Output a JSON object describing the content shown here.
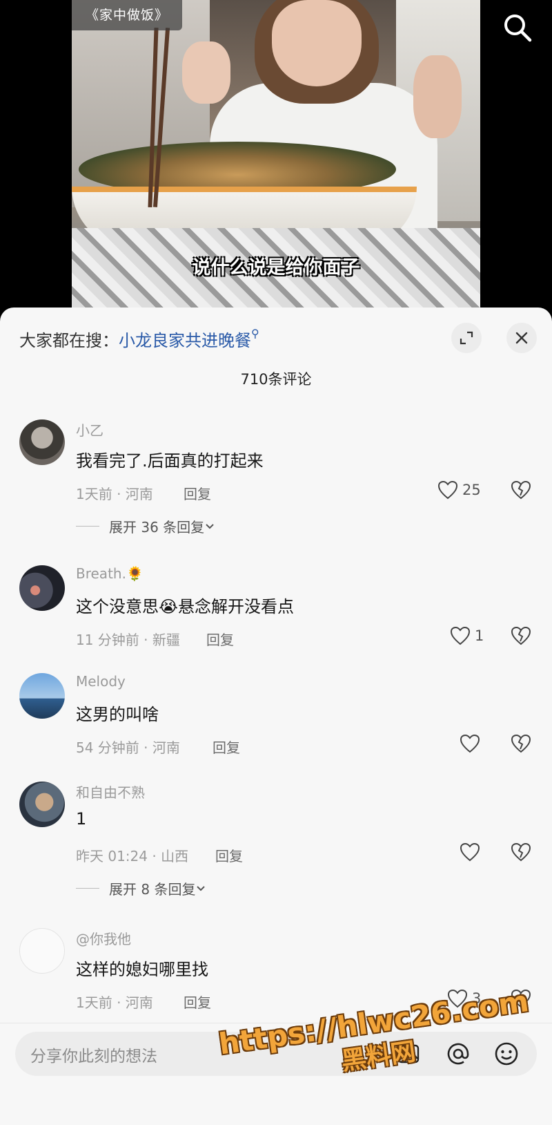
{
  "video": {
    "tag": "《家中做饭》",
    "subtitle": "说什么说是给你面子"
  },
  "sheet": {
    "search_prefix": "大家都在搜：",
    "search_keyword": "小龙良家共进晚餐",
    "comment_count": "710条评论"
  },
  "comments": [
    {
      "name": "小乙",
      "text": "我看完了.后面真的打起来",
      "meta": "1天前 · 河南",
      "reply": "回复",
      "likes": "25",
      "expand": "展开 36 条回复"
    },
    {
      "name": "Breath.🌻",
      "text": "这个没意思😭悬念解开没看点",
      "meta": "11 分钟前 · 新疆",
      "reply": "回复",
      "likes": "1"
    },
    {
      "name": "Melody",
      "text": "这男的叫啥",
      "meta": "54 分钟前 · 河南",
      "reply": "回复",
      "likes": ""
    },
    {
      "name": "和自由不熟",
      "text": "1",
      "meta": "昨天 01:24 · 山西",
      "reply": "回复",
      "likes": "",
      "expand": "展开 8 条回复"
    },
    {
      "name": "@你我他",
      "text": "这样的媳妇哪里找",
      "meta": "1天前 · 河南",
      "reply": "回复",
      "likes": "3"
    }
  ],
  "input": {
    "placeholder": "分享你此刻的想法"
  },
  "watermark": {
    "url": "https://hlwc26.com",
    "name": "黑料网"
  },
  "icons": {
    "video_search": "search-icon",
    "expand": "expand-icon",
    "close": "close-icon",
    "like": "heart-icon",
    "dislike": "broken-heart-icon",
    "image": "image-icon",
    "mention": "at-icon",
    "emoji": "emoji-icon"
  },
  "colors": {
    "keyword": "#2a5aa8",
    "sheet_bg": "#f7f7f7",
    "watermark": "#f2a53a"
  }
}
